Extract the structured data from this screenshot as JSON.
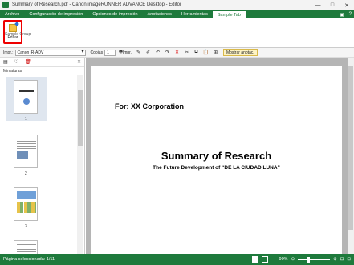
{
  "window": {
    "title": "Summary of Research.pdf - Canon imageRUNNER ADVANCE Desktop - Editor",
    "controls": [
      "—",
      "□",
      "✕"
    ]
  },
  "ribbon": {
    "tabs": [
      {
        "label": "Archivo",
        "active": false
      },
      {
        "label": "Configuración de impresión",
        "active": false
      },
      {
        "label": "Opciones de impresión",
        "active": false
      },
      {
        "label": "Anotaciones",
        "active": false
      },
      {
        "label": "Herramientas",
        "active": false
      },
      {
        "label": "Sample Tab",
        "active": true
      }
    ],
    "editar_label": "Editar",
    "group_label": "Sample Group"
  },
  "toolbar": {
    "printer_label": "Impr.:",
    "printer_value": "Canon iR-ADV",
    "copies_label": "Copias",
    "copies_value": "1",
    "print_label": "Impr.",
    "show_annotations": "Mostrar anotac."
  },
  "left_panel": {
    "thumbnails_label": "Miniaturas",
    "pages": [
      "1",
      "2",
      "3"
    ]
  },
  "document": {
    "for_line": "For: XX Corporation",
    "title": "Summary of Research",
    "subtitle": "The Future Development of “DE LA CIUDAD LUNA”"
  },
  "status": {
    "selected_page": "Página seleccionada: 1/11",
    "zoom": "90%"
  },
  "colors": {
    "accent": "#1e7a3c",
    "highlight": "#e00000"
  }
}
